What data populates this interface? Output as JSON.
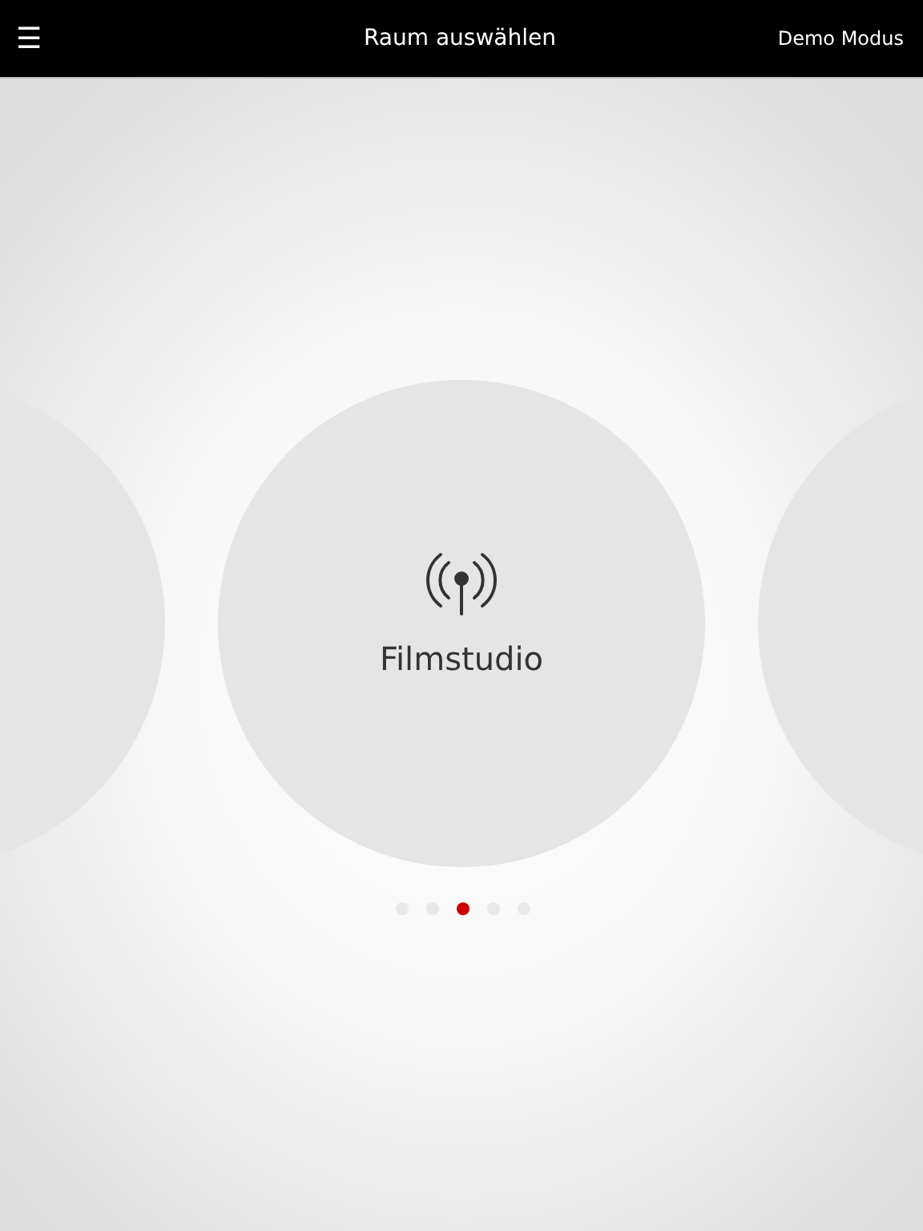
{
  "header": {
    "menu_icon": "☰",
    "title": "Raum auswählen",
    "action": "Demo Modus"
  },
  "rooms": [
    {
      "kind": "neighbor"
    },
    {
      "kind": "current",
      "name": "Filmstudio"
    },
    {
      "kind": "neighbor"
    }
  ],
  "pager": [
    {
      "selected": false
    },
    {
      "selected": false
    },
    {
      "selected": true
    },
    {
      "selected": false
    },
    {
      "selected": false
    }
  ]
}
